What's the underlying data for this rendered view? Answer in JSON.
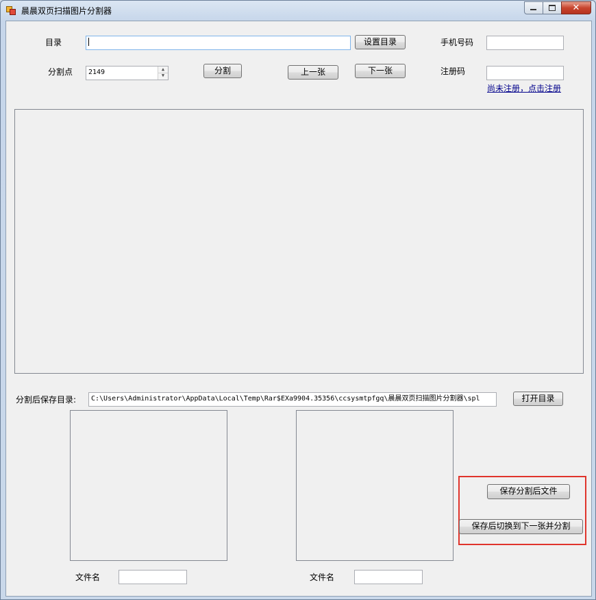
{
  "window": {
    "title": "晨晨双页扫描图片分割器",
    "min_symbol": "",
    "max_symbol": "",
    "close_symbol": "✕"
  },
  "directory": {
    "label": "目录",
    "value": "",
    "set_button": "设置目录"
  },
  "split": {
    "label": "分割点",
    "value": "2149",
    "spin_up": "▲",
    "spin_down": "▼",
    "split_button": "分割",
    "prev_button": "上一张",
    "next_button": "下一张"
  },
  "registration": {
    "phone_label": "手机号码",
    "phone_value": "",
    "code_label": "注册码",
    "code_value": "",
    "register_link": "尚未注册，点击注册"
  },
  "output": {
    "label": "分割后保存目录:",
    "path": "C:\\Users\\Administrator\\AppData\\Local\\Temp\\Rar$EXa9904.35356\\ccsysmtpfgq\\晨晨双页扫描图片分割器\\spl",
    "open_button": "打开目录"
  },
  "left_file": {
    "label": "文件名",
    "value": ""
  },
  "right_file": {
    "label": "文件名",
    "value": ""
  },
  "actions": {
    "save_button": "保存分割后文件",
    "save_next_button": "保存后切换到下一张并分割"
  },
  "colors": {
    "highlight": "#e0342b",
    "link": "#00008b"
  }
}
